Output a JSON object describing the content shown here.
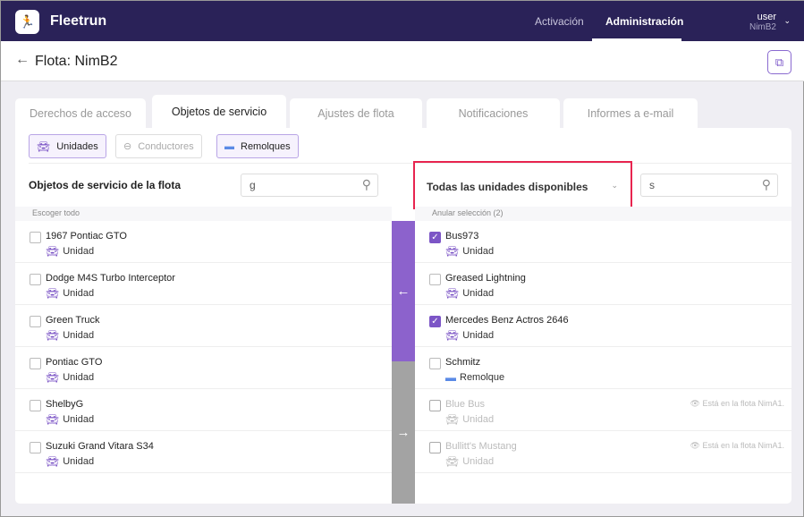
{
  "header": {
    "brand": "Fleetrun",
    "nav": [
      "Activación",
      "Administración"
    ],
    "user": "user",
    "fleet": "NimB2"
  },
  "page": {
    "title": "Flota: NimB2"
  },
  "tabs": [
    "Derechos de acceso",
    "Objetos de servicio",
    "Ajustes de flota",
    "Notificaciones",
    "Informes a e-mail"
  ],
  "filters": [
    "Unidades",
    "Conductores",
    "Remolques"
  ],
  "left": {
    "title": "Objetos de servicio de la flota",
    "search": "g",
    "select_all": "Escoger todo",
    "items": [
      {
        "name": "1967 Pontiac GTO",
        "type": "Unidad"
      },
      {
        "name": "Dodge M4S Turbo Interceptor",
        "type": "Unidad"
      },
      {
        "name": "Green Truck",
        "type": "Unidad"
      },
      {
        "name": "Pontiac GTO",
        "type": "Unidad"
      },
      {
        "name": "ShelbyG",
        "type": "Unidad"
      },
      {
        "name": "Suzuki Grand Vitara S34",
        "type": "Unidad"
      }
    ]
  },
  "right": {
    "dropdown": "Todas las unidades disponibles",
    "search": "s",
    "deselect": "Anular selección (2)",
    "items": [
      {
        "name": "Bus973",
        "type": "Unidad",
        "checked": true
      },
      {
        "name": "Greased Lightning",
        "type": "Unidad"
      },
      {
        "name": "Mercedes Benz Actros 2646",
        "type": "Unidad",
        "checked": true
      },
      {
        "name": "Schmitz",
        "type": "Remolque"
      },
      {
        "name": "Blue Bus",
        "type": "Unidad",
        "note": "Está en la flota NimA1."
      },
      {
        "name": "Bullitt's Mustang",
        "type": "Unidad",
        "note": "Está en la flota NimA1."
      }
    ]
  },
  "colors": {
    "header": "#2a2258",
    "accent": "#7c55c6",
    "highlight": "#e8244f"
  }
}
